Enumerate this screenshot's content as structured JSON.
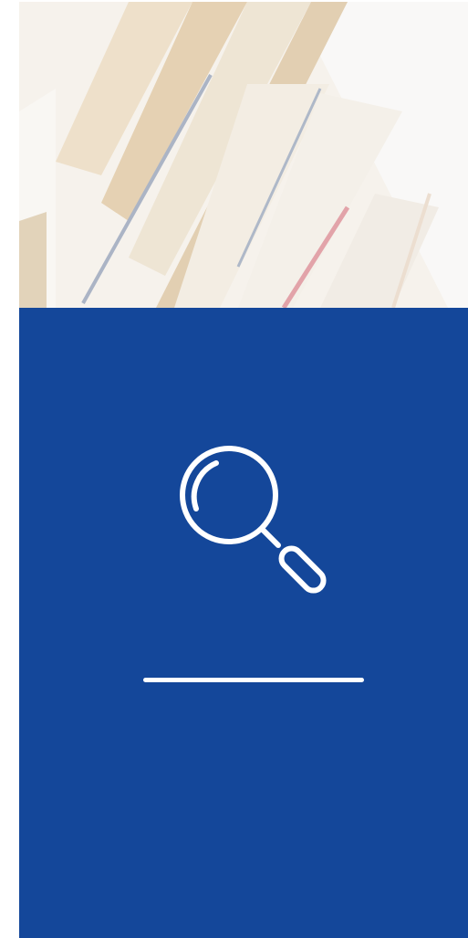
{
  "hero": {
    "image": "books-on-shelf-photo"
  },
  "panel": {
    "background_color": "#14479a",
    "icon": "search-icon",
    "icon_color": "#ffffff"
  }
}
